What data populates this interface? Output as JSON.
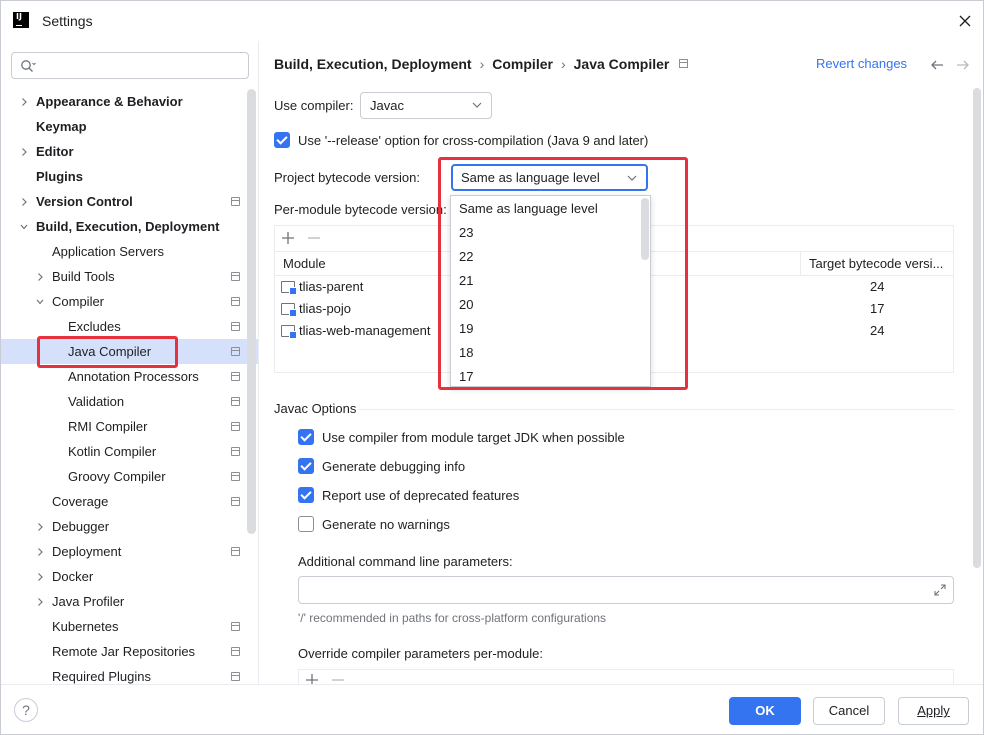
{
  "window": {
    "title": "Settings"
  },
  "search": {
    "placeholder": ""
  },
  "sidebar": {
    "items": [
      {
        "label": "Appearance & Behavior",
        "level": 0,
        "bold": true,
        "chevron": "right",
        "proj": false
      },
      {
        "label": "Keymap",
        "level": 0,
        "bold": true,
        "chevron": "none",
        "proj": false
      },
      {
        "label": "Editor",
        "level": 0,
        "bold": true,
        "chevron": "right",
        "proj": false
      },
      {
        "label": "Plugins",
        "level": 0,
        "bold": true,
        "chevron": "none",
        "proj": false
      },
      {
        "label": "Version Control",
        "level": 0,
        "bold": true,
        "chevron": "right",
        "proj": true
      },
      {
        "label": "Build, Execution, Deployment",
        "level": 0,
        "bold": true,
        "chevron": "down",
        "proj": false
      },
      {
        "label": "Application Servers",
        "level": 1,
        "bold": false,
        "chevron": "none",
        "proj": false
      },
      {
        "label": "Build Tools",
        "level": 1,
        "bold": false,
        "chevron": "right",
        "proj": true
      },
      {
        "label": "Compiler",
        "level": 1,
        "bold": false,
        "chevron": "down",
        "proj": true
      },
      {
        "label": "Excludes",
        "level": 2,
        "bold": false,
        "chevron": "none",
        "proj": true
      },
      {
        "label": "Java Compiler",
        "level": 2,
        "bold": false,
        "chevron": "none",
        "proj": true,
        "selected": true
      },
      {
        "label": "Annotation Processors",
        "level": 2,
        "bold": false,
        "chevron": "none",
        "proj": true
      },
      {
        "label": "Validation",
        "level": 2,
        "bold": false,
        "chevron": "none",
        "proj": true
      },
      {
        "label": "RMI Compiler",
        "level": 2,
        "bold": false,
        "chevron": "none",
        "proj": true
      },
      {
        "label": "Kotlin Compiler",
        "level": 2,
        "bold": false,
        "chevron": "none",
        "proj": true
      },
      {
        "label": "Groovy Compiler",
        "level": 2,
        "bold": false,
        "chevron": "none",
        "proj": true
      },
      {
        "label": "Coverage",
        "level": 1,
        "bold": false,
        "chevron": "none",
        "proj": true
      },
      {
        "label": "Debugger",
        "level": 1,
        "bold": false,
        "chevron": "right",
        "proj": false
      },
      {
        "label": "Deployment",
        "level": 1,
        "bold": false,
        "chevron": "right",
        "proj": true
      },
      {
        "label": "Docker",
        "level": 1,
        "bold": false,
        "chevron": "right",
        "proj": false
      },
      {
        "label": "Java Profiler",
        "level": 1,
        "bold": false,
        "chevron": "right",
        "proj": false
      },
      {
        "label": "Kubernetes",
        "level": 1,
        "bold": false,
        "chevron": "none",
        "proj": true
      },
      {
        "label": "Remote Jar Repositories",
        "level": 1,
        "bold": false,
        "chevron": "none",
        "proj": true
      },
      {
        "label": "Required Plugins",
        "level": 1,
        "bold": false,
        "chevron": "none",
        "proj": true
      }
    ]
  },
  "breadcrumb": {
    "parts": [
      "Build, Execution, Deployment",
      "Compiler",
      "Java Compiler"
    ],
    "revert_label": "Revert changes"
  },
  "form": {
    "use_compiler_label": "Use compiler:",
    "use_compiler_value": "Javac",
    "release_option_label": "Use '--release' option for cross-compilation (Java 9 and later)",
    "release_option_checked": true,
    "bytecode_label": "Project bytecode version:",
    "bytecode_value": "Same as language level",
    "per_module_label": "Per-module bytecode version:",
    "table": {
      "col_module": "Module",
      "col_target": "Target bytecode versi...",
      "rows": [
        {
          "module": "tlias-parent",
          "target": "24"
        },
        {
          "module": "tlias-pojo",
          "target": "17"
        },
        {
          "module": "tlias-web-management",
          "target": "24"
        }
      ]
    },
    "javac_options_title": "Javac Options",
    "options": [
      {
        "label": "Use compiler from module target JDK when possible",
        "checked": true
      },
      {
        "label": "Generate debugging info",
        "checked": true
      },
      {
        "label": "Report use of deprecated features",
        "checked": true
      },
      {
        "label": "Generate no warnings",
        "checked": false
      }
    ],
    "additional_params_label": "Additional command line parameters:",
    "additional_params_value": "",
    "additional_params_hint": "'/' recommended in paths for cross-platform configurations",
    "override_label": "Override compiler parameters per-module:"
  },
  "dropdown": {
    "options": [
      "Same as language level",
      "23",
      "22",
      "21",
      "20",
      "19",
      "18",
      "17"
    ]
  },
  "footer": {
    "help_label": "?",
    "ok_label": "OK",
    "cancel_label": "Cancel",
    "apply_label": "Apply"
  },
  "colors": {
    "accent": "#3574f0",
    "selection": "#d5e1fb",
    "annotation_red": "#e5323e"
  }
}
